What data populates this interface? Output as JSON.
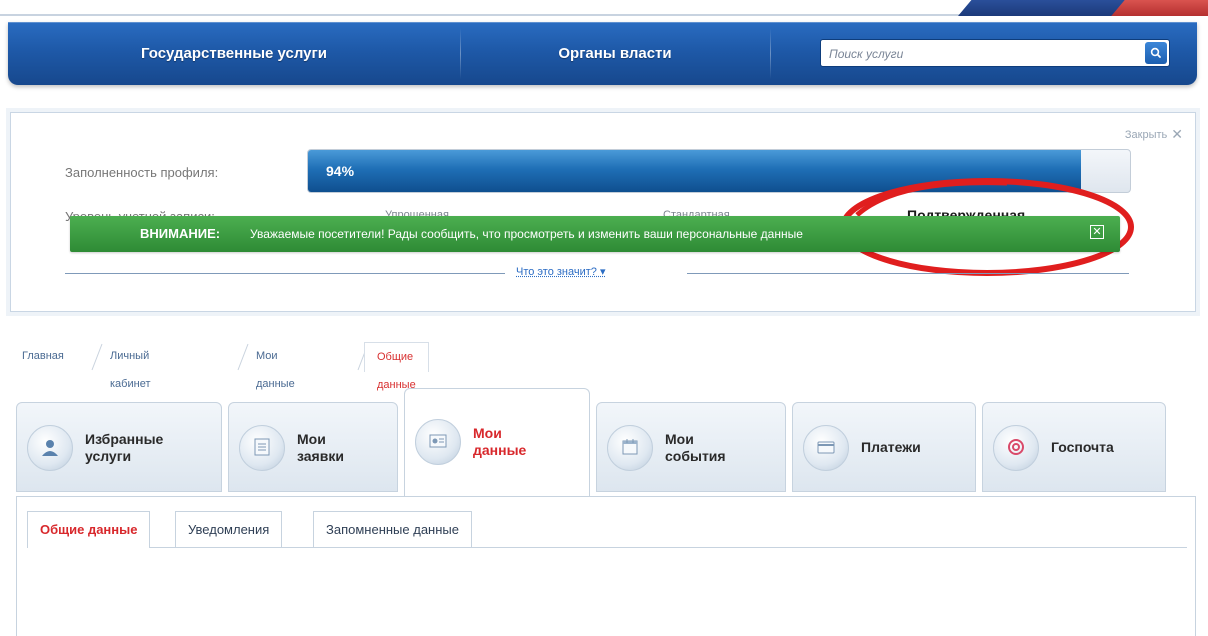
{
  "nav": {
    "items": [
      "Государственные услуги",
      "Органы власти"
    ],
    "search_placeholder": "Поиск услуги"
  },
  "profile": {
    "close_label": "Закрыть",
    "fill_label": "Заполненность профиля:",
    "fill_text": "94%",
    "fill_fraction": 0.94,
    "level_label": "Уровень учетной записи:",
    "levels": [
      "Упрощенная",
      "Стандартная",
      "Подтвержденная"
    ],
    "highlighted_level": "Подтвержденная",
    "what_link": "Что это значит? ▾",
    "accent_blue": "#1f6fb6",
    "highlight_color": "#d8282c"
  },
  "breadcrumb": [
    "Главная",
    "Личный кабинет",
    "Мои данные",
    "Общие данные"
  ],
  "sections": [
    {
      "line1": "Избранные",
      "line2": "услуги",
      "icon": "user-icon",
      "active": false
    },
    {
      "line1": "Мои",
      "line2": "заявки",
      "icon": "list-icon",
      "active": false
    },
    {
      "line1": "Мои",
      "line2": "данные",
      "icon": "profile-card-icon",
      "active": true
    },
    {
      "line1": "Мои",
      "line2": "события",
      "icon": "calendar-icon",
      "active": false
    },
    {
      "line1": "Платежи",
      "line2": "",
      "icon": "payment-icon",
      "active": false
    },
    {
      "line1": "Госпочта",
      "line2": "",
      "icon": "at-sign-icon",
      "active": false
    }
  ],
  "subtabs": [
    "Общие данные",
    "Уведомления",
    "Запомненные данные"
  ],
  "notice": {
    "head": "ВНИМАНИЕ:",
    "text": "Уважаемые посетители! Рады сообщить, что просмотреть и изменить ваши персональные данные",
    "color": "#3a9c3f"
  }
}
